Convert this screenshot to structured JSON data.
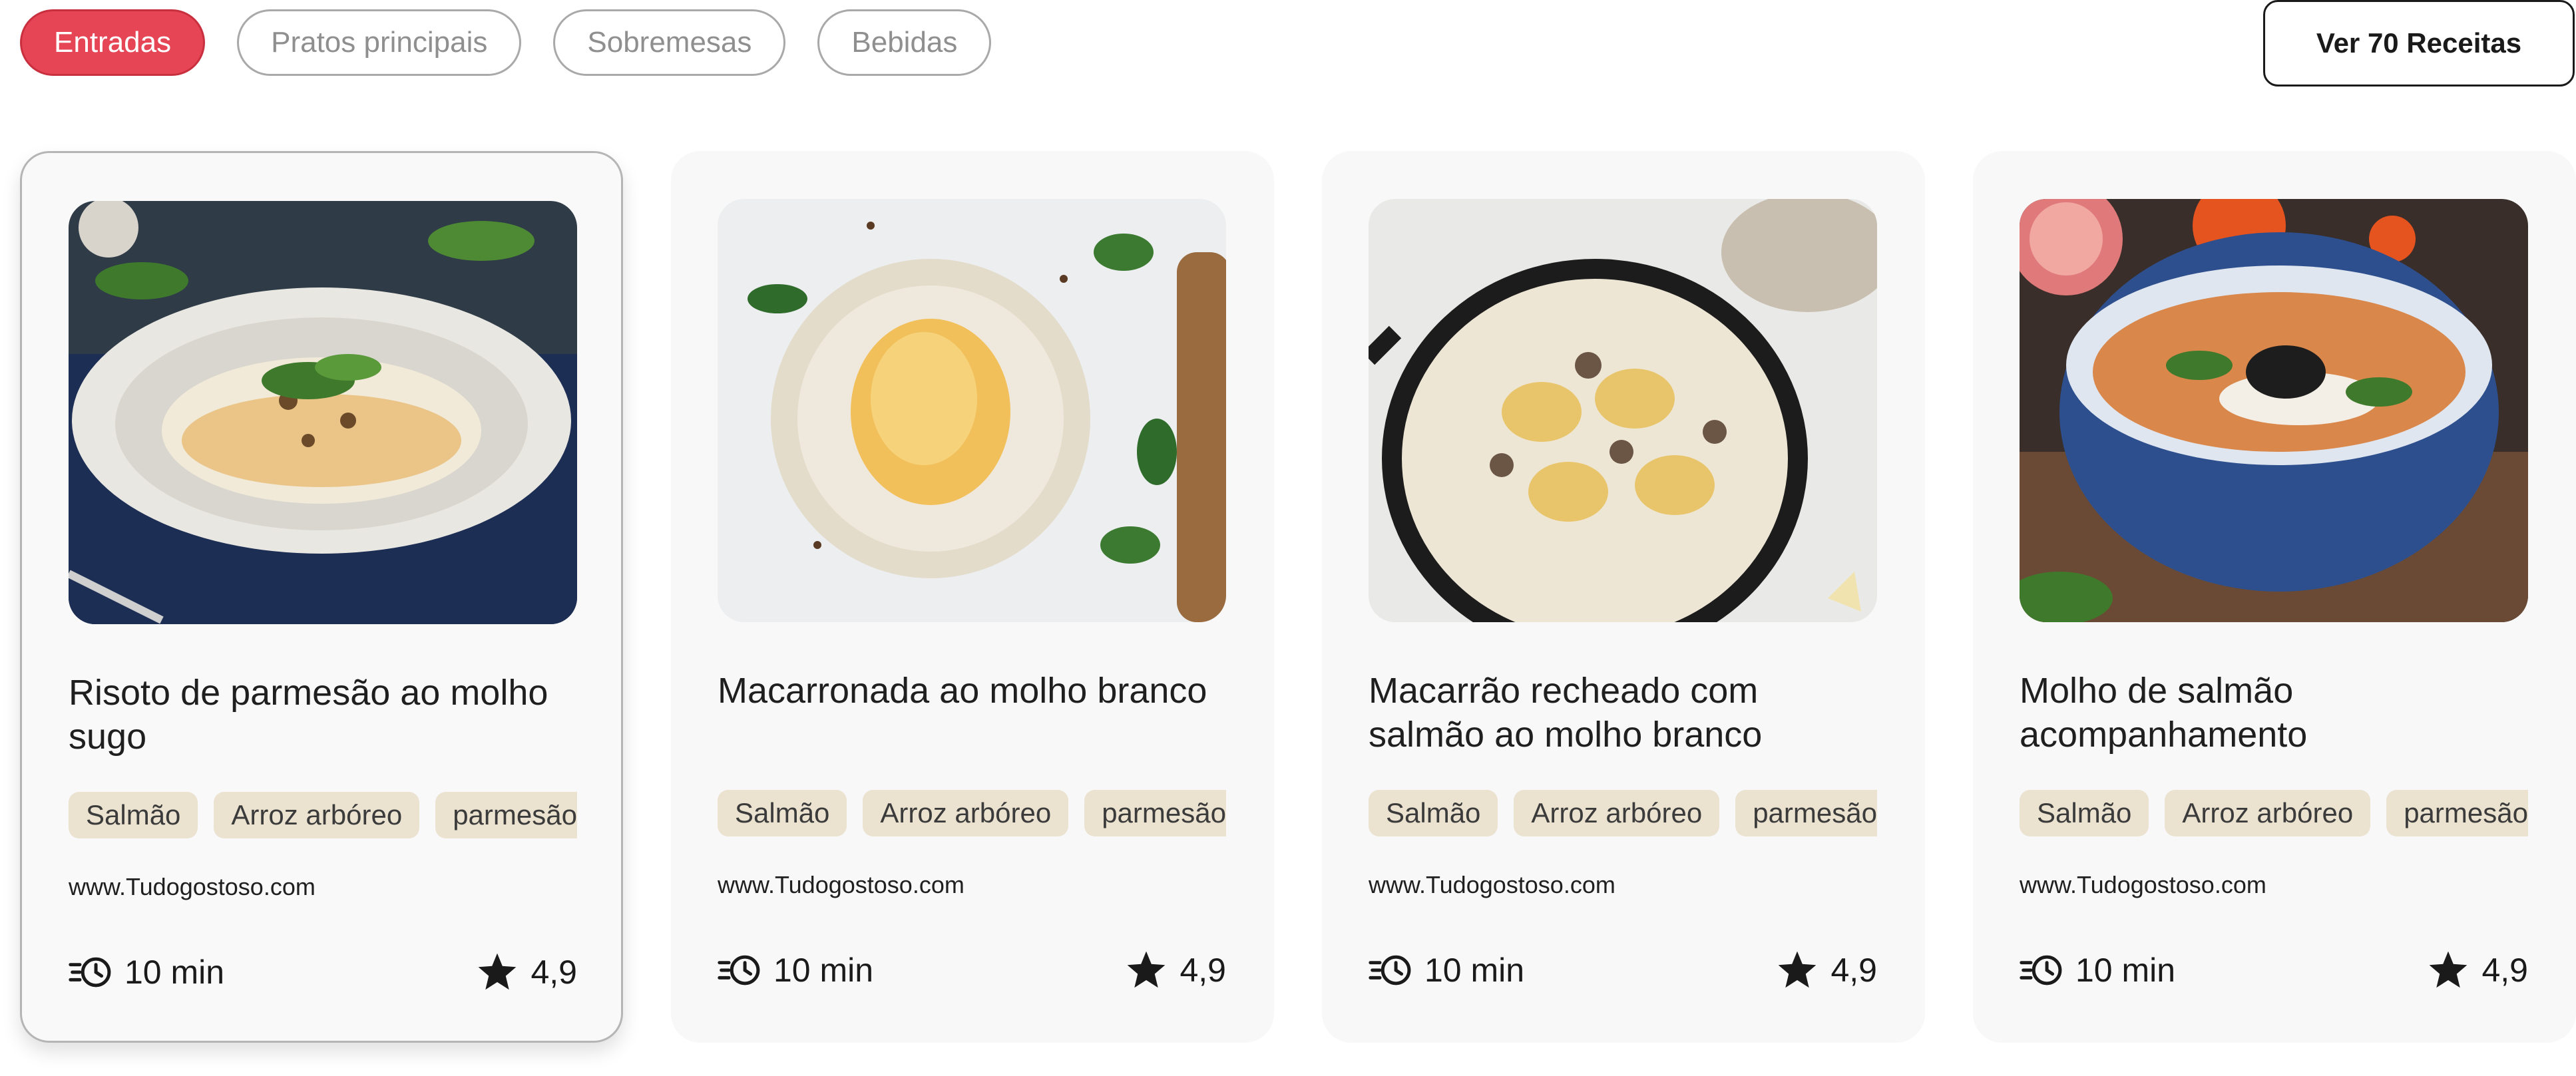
{
  "filters": {
    "chips": [
      {
        "label": "Entradas",
        "active": true
      },
      {
        "label": "Pratos principais",
        "active": false
      },
      {
        "label": "Sobremesas",
        "active": false
      },
      {
        "label": "Bebidas",
        "active": false
      }
    ],
    "see_all_label": "Ver 70 Receitas"
  },
  "cards": [
    {
      "title": "Risoto de parmesão ao molho sugo",
      "image": "risotto-dish-photo",
      "tags": [
        "Salmão",
        "Arroz arbóreo",
        "parmesão"
      ],
      "source": "www.Tudogostoso.com",
      "time": "10 min",
      "rating": "4,9",
      "selected": true
    },
    {
      "title": "Macarronada ao molho branco",
      "image": "fettuccine-plate-photo",
      "tags": [
        "Salmão",
        "Arroz arbóreo",
        "parmesão"
      ],
      "source": "www.Tudogostoso.com",
      "time": "10 min",
      "rating": "4,9",
      "selected": false
    },
    {
      "title": "Macarrão recheado com salmão ao molho branco",
      "image": "ravioli-skillet-photo",
      "tags": [
        "Salmão",
        "Arroz arbóreo",
        "parmesão"
      ],
      "source": "www.Tudogostoso.com",
      "time": "10 min",
      "rating": "4,9",
      "selected": false
    },
    {
      "title": "Molho de salmão acompanhamento",
      "image": "soup-bowl-photo",
      "tags": [
        "Salmão",
        "Arroz arbóreo",
        "parmesão"
      ],
      "source": "www.Tudogostoso.com",
      "time": "10 min",
      "rating": "4,9",
      "selected": false
    }
  ],
  "icons": {
    "time": "clock-icon",
    "rating": "star-icon"
  },
  "colors": {
    "accent": "#e64555",
    "tag_bg": "#ebe2d0",
    "card_bg": "#f8f8f8"
  }
}
